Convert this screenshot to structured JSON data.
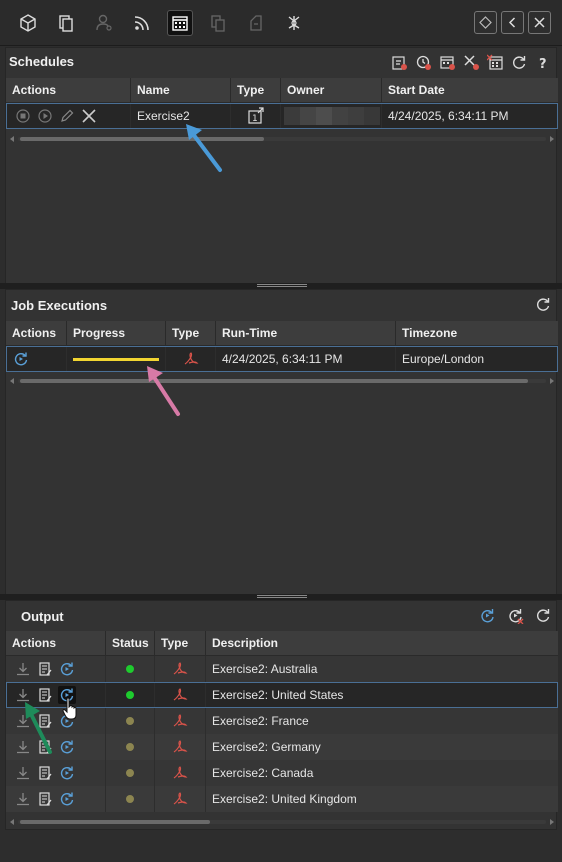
{
  "toolbar": {
    "icons": [
      "cube-icon",
      "pages-icon",
      "user-settings-icon",
      "rss-icon",
      "calendar-icon",
      "database-icon",
      "reports-icon",
      "tree-icon"
    ],
    "right_buttons": [
      "diamond-icon",
      "back-icon",
      "close-icon"
    ]
  },
  "schedules": {
    "title": "Schedules",
    "columns": [
      "Actions",
      "Name",
      "Type",
      "Owner",
      "Start Date"
    ],
    "row": {
      "name": "Exercise2",
      "start_date": "4/24/2025, 6:34:11 PM"
    }
  },
  "job_executions": {
    "title": "Job Executions",
    "columns": [
      "Actions",
      "Progress",
      "Type",
      "Run-Time",
      "Timezone"
    ],
    "row": {
      "progress_pct": 100,
      "run_time": "4/24/2025, 6:34:11 PM",
      "timezone": "Europe/London"
    }
  },
  "output": {
    "title": "Output",
    "columns": [
      "Actions",
      "Status",
      "Type",
      "Description"
    ],
    "rows": [
      {
        "status": "green",
        "description": "Exercise2: Australia"
      },
      {
        "status": "green",
        "description": "Exercise2: United States"
      },
      {
        "status": "olive",
        "description": "Exercise2: France"
      },
      {
        "status": "olive",
        "description": "Exercise2: Germany"
      },
      {
        "status": "olive",
        "description": "Exercise2: Canada"
      },
      {
        "status": "olive",
        "description": "Exercise2: United Kingdom"
      }
    ]
  },
  "colors": {
    "status_green": "#1ecb2e",
    "status_olive": "#8c8550",
    "progress": "#f2d531",
    "pdf": "#d9534a",
    "arrow_blue": "#4a9ad8",
    "arrow_pink": "#d77aa6",
    "arrow_green": "#1e8b5a"
  }
}
